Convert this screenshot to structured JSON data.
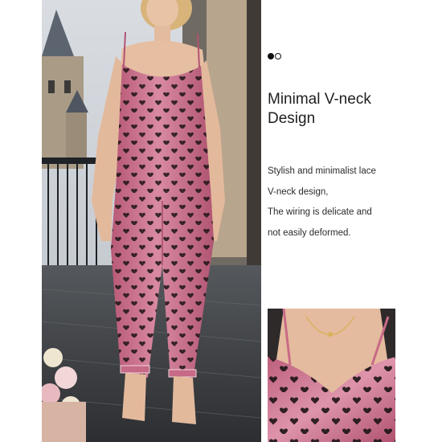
{
  "heading": {
    "line1": "Minimal V-neck",
    "line2": "Design"
  },
  "description": {
    "lines": [
      "Stylish and minimalist lace",
      "V-neck design,",
      "The wiring is delicate and",
      "not easily deformed."
    ]
  },
  "carousel": {
    "total": 2,
    "active_index": 0
  },
  "colors": {
    "satin_pink": "#c66a86",
    "heart_print": "#1c1416",
    "background": "#ffffff",
    "text": "#1f1f1f"
  },
  "icons": [
    "carousel-dot-active-icon",
    "carousel-dot-inactive-icon"
  ]
}
